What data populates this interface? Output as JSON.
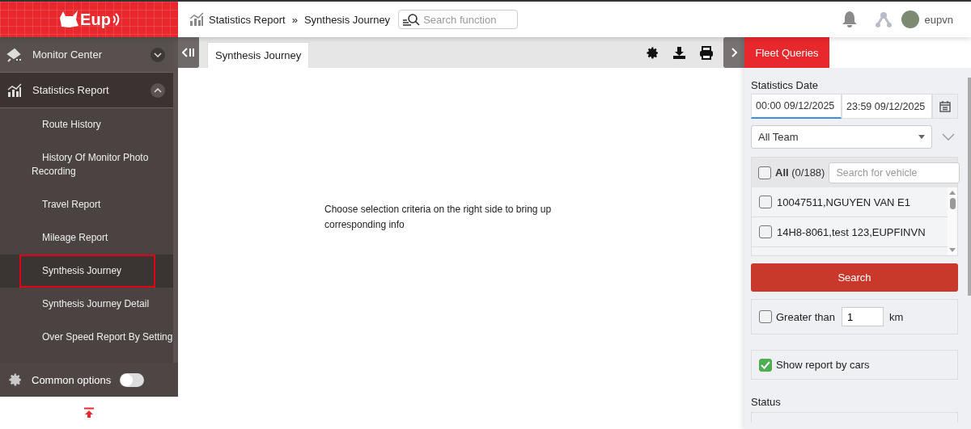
{
  "header": {
    "logo": "Eup",
    "breadcrumb": [
      "Statistics Report",
      "Synthesis Journey"
    ],
    "separator": "»",
    "search": {
      "placeholder": "Search function"
    },
    "user": "eupvn"
  },
  "sidebar": {
    "groups": [
      {
        "label": "Monitor Center",
        "expanded": false
      },
      {
        "label": "Statistics Report",
        "expanded": true
      }
    ],
    "items": [
      {
        "label": "Route History",
        "selected": false
      },
      {
        "label": "History Of Monitor Photo Recording",
        "selected": false
      },
      {
        "label": "Travel Report",
        "selected": false
      },
      {
        "label": "Mileage Report",
        "selected": false
      },
      {
        "label": "Synthesis Journey",
        "selected": true
      },
      {
        "label": "Synthesis Journey Detail",
        "selected": false
      },
      {
        "label": "Over Speed Report By Setting",
        "selected": false
      }
    ],
    "common_options": {
      "label": "Common options",
      "on": false
    }
  },
  "tabs": [
    {
      "label": "Synthesis Journey",
      "selected": true
    }
  ],
  "message": "Choose selection criteria on the right side to bring up corresponding info",
  "panel": {
    "tab": "Fleet Queries",
    "date_label": "Statistics Date",
    "start": "00:00 09/12/2025",
    "end": "23:59 09/12/2025",
    "team": "All Team",
    "all": {
      "label": "All",
      "count": "(0/188)",
      "checked": false
    },
    "vehicle_search": {
      "placeholder": "Search for vehicle"
    },
    "vehicles": [
      {
        "name": "10047511,NGUYEN VAN E1",
        "checked": false
      },
      {
        "name": "14H8-8061,test 123,EUPFINVN",
        "checked": false
      }
    ],
    "search_button": "Search",
    "greater": {
      "label": "Greater than",
      "value": "1",
      "unit": "km",
      "checked": false
    },
    "show_by_cars": {
      "label": "Show report by cars",
      "checked": true
    },
    "status_label": "Status"
  }
}
